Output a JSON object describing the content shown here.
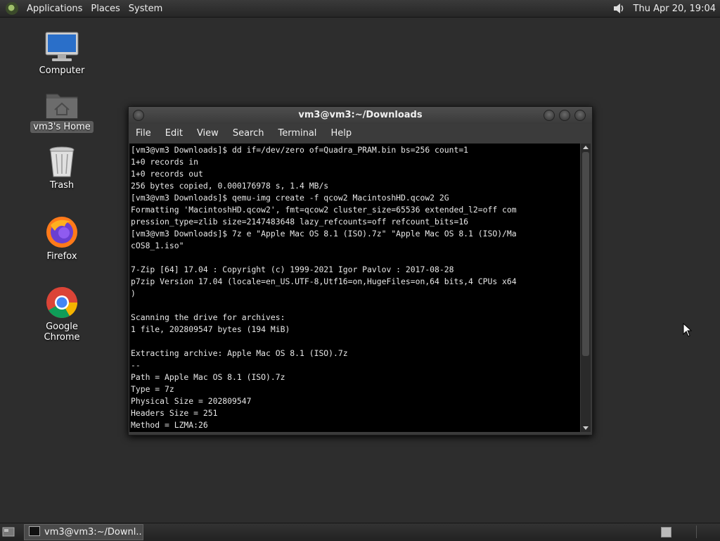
{
  "top_panel": {
    "menus": [
      "Applications",
      "Places",
      "System"
    ],
    "clock": "Thu Apr 20, 19:04"
  },
  "desktop": {
    "icons": [
      {
        "label": "Computer",
        "icon": "computer-icon"
      },
      {
        "label": "vm3's Home",
        "icon": "home-folder-icon"
      },
      {
        "label": "Trash",
        "icon": "trash-icon"
      },
      {
        "label": "Firefox",
        "icon": "firefox-icon"
      },
      {
        "label": "Google Chrome",
        "icon": "chrome-icon"
      }
    ]
  },
  "terminal": {
    "title": "vm3@vm3:~/Downloads",
    "menu": [
      "File",
      "Edit",
      "View",
      "Search",
      "Terminal",
      "Help"
    ],
    "lines": [
      "[vm3@vm3 Downloads]$ dd if=/dev/zero of=Quadra_PRAM.bin bs=256 count=1",
      "1+0 records in",
      "1+0 records out",
      "256 bytes copied, 0.000176978 s, 1.4 MB/s",
      "[vm3@vm3 Downloads]$ qemu-img create -f qcow2 MacintoshHD.qcow2 2G",
      "Formatting 'MacintoshHD.qcow2', fmt=qcow2 cluster_size=65536 extended_l2=off com",
      "pression_type=zlib size=2147483648 lazy_refcounts=off refcount_bits=16",
      "[vm3@vm3 Downloads]$ 7z e \"Apple Mac OS 8.1 (ISO).7z\" \"Apple Mac OS 8.1 (ISO)/Ma",
      "cOS8_1.iso\"",
      "",
      "7-Zip [64] 17.04 : Copyright (c) 1999-2021 Igor Pavlov : 2017-08-28",
      "p7zip Version 17.04 (locale=en_US.UTF-8,Utf16=on,HugeFiles=on,64 bits,4 CPUs x64",
      ")",
      "",
      "Scanning the drive for archives:",
      "1 file, 202809547 bytes (194 MiB)",
      "",
      "Extracting archive: Apple Mac OS 8.1 (ISO).7z",
      "--",
      "Path = Apple Mac OS 8.1 (ISO).7z",
      "Type = 7z",
      "Physical Size = 202809547",
      "Headers Size = 251",
      "Method = LZMA:26"
    ]
  },
  "taskbar": {
    "window_button": "vm3@vm3:~/Downl..."
  }
}
